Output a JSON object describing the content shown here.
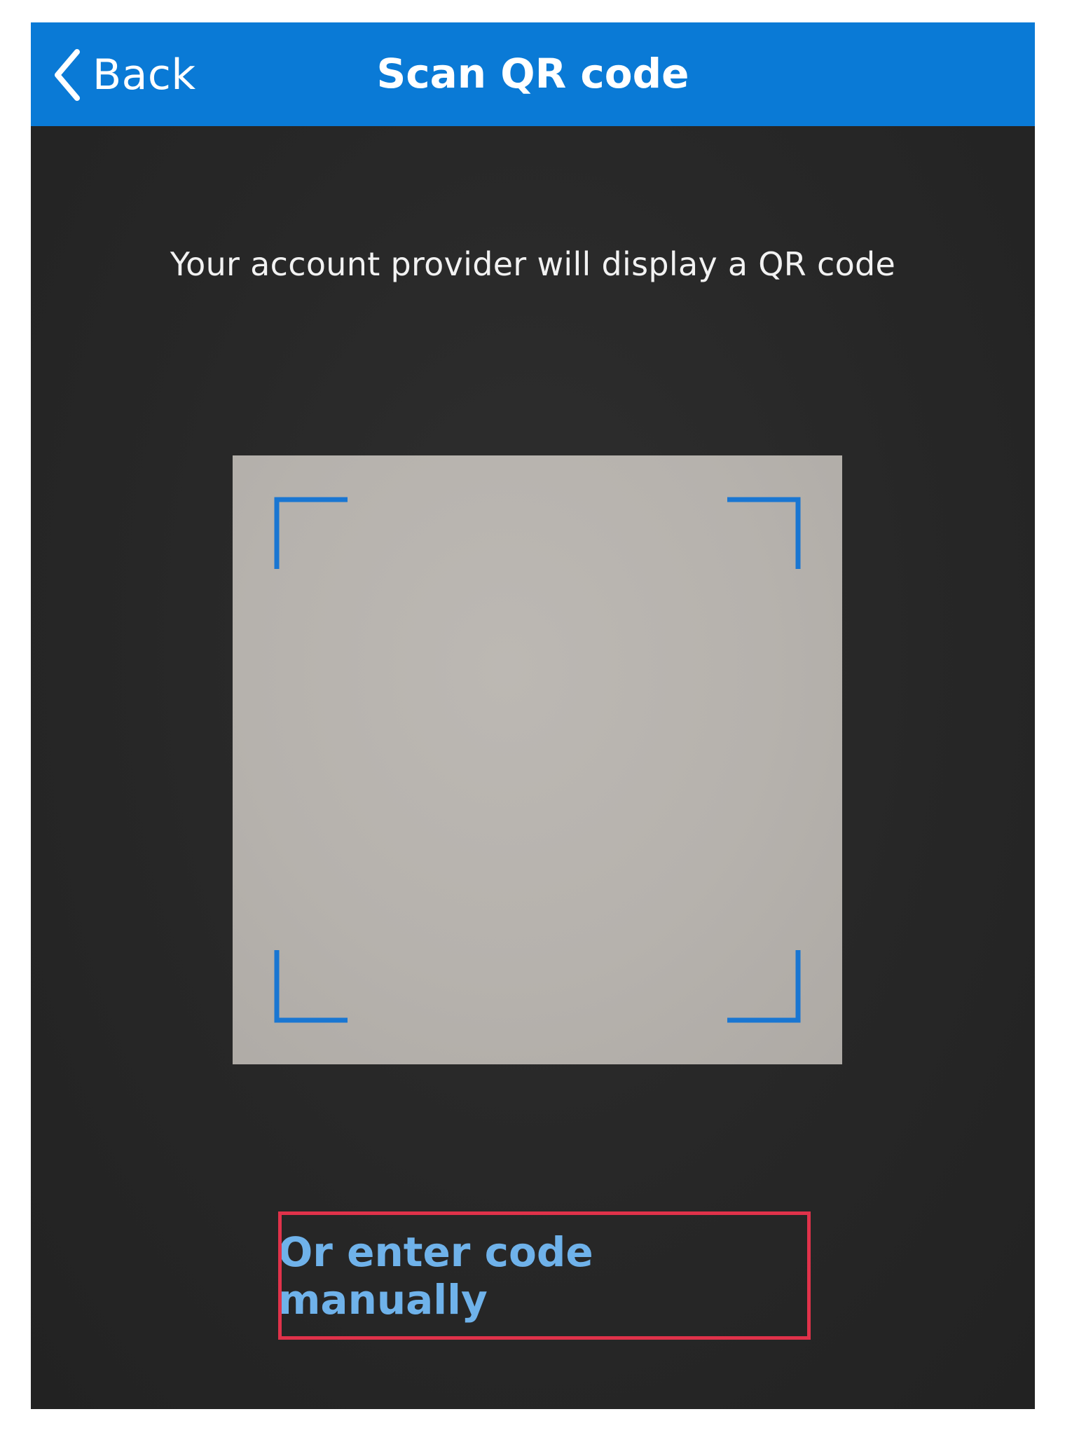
{
  "navbar": {
    "back_label": "Back",
    "title": "Scan QR code",
    "back_icon": "chevron-left-icon"
  },
  "main": {
    "instruction": "Your account provider will display a QR code",
    "manual_link_label": "Or enter code manually"
  },
  "colors": {
    "navbar_bg": "#0a7ad6",
    "camera_bg": "#262626",
    "corner_accent": "#1976d2",
    "link": "#6fb2ea",
    "highlight_border": "#e0324a"
  }
}
